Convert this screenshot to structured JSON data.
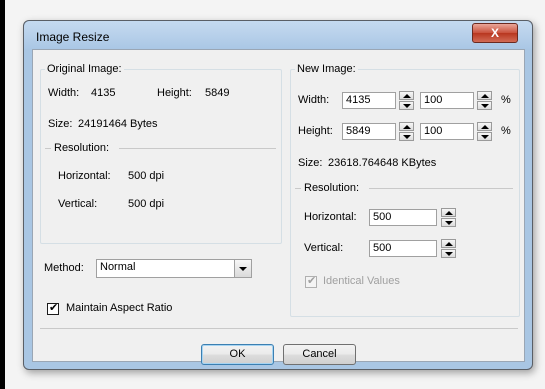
{
  "window": {
    "title": "Image Resize",
    "close_glyph": "X"
  },
  "original": {
    "legend": "Original Image:",
    "width_label": "Width:",
    "width_value": "4135",
    "height_label": "Height:",
    "height_value": "5849",
    "size_label": "Size:",
    "size_value": "24191464 Bytes",
    "res_legend": "Resolution:",
    "horizontal_label": "Horizontal:",
    "horizontal_value": "500 dpi",
    "vertical_label": "Vertical:",
    "vertical_value": "500 dpi"
  },
  "method": {
    "label": "Method:",
    "value": "Normal"
  },
  "aspect": {
    "label": "Maintain Aspect Ratio",
    "checked": true
  },
  "new_image": {
    "legend": "New Image:",
    "width_label": "Width:",
    "width_value": "4135",
    "width_pct": "100",
    "height_label": "Height:",
    "height_value": "5849",
    "height_pct": "100",
    "pct_symbol": "%",
    "size_label": "Size:",
    "size_value": "23618.764648 KBytes",
    "res_legend": "Resolution:",
    "horizontal_label": "Horizontal:",
    "horizontal_value": "500",
    "vertical_label": "Vertical:",
    "vertical_value": "500",
    "identical_label": "Identical Values",
    "identical_checked": true
  },
  "buttons": {
    "ok": "OK",
    "cancel": "Cancel"
  }
}
